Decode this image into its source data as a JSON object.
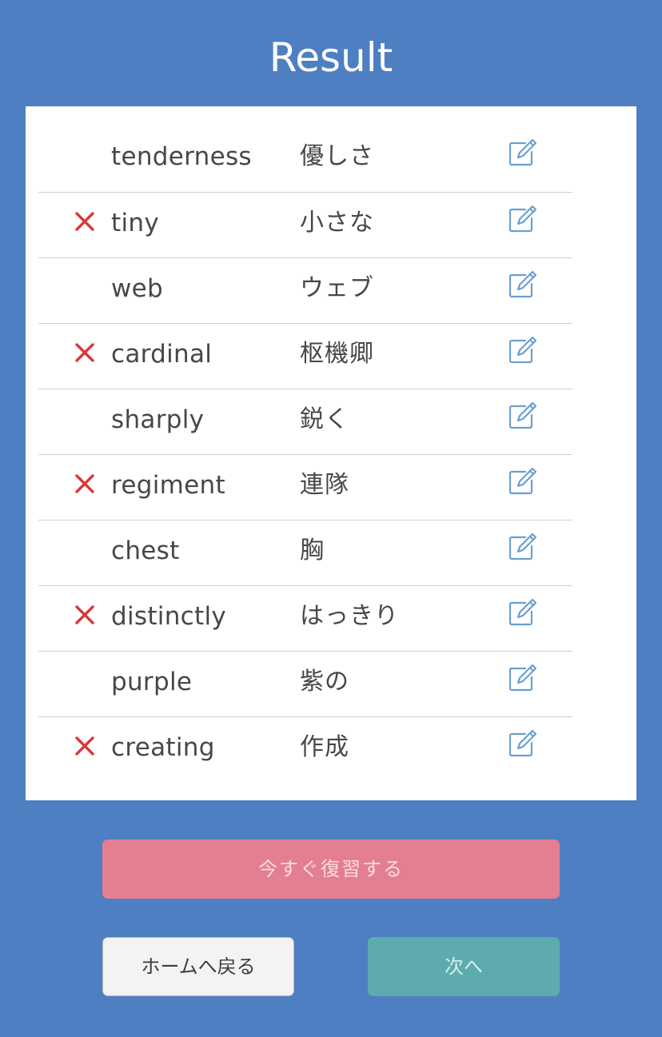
{
  "header": {
    "title": "Result"
  },
  "results": {
    "items": [
      {
        "word": "tenderness",
        "meaning": "優しさ",
        "incorrect": false
      },
      {
        "word": "tiny",
        "meaning": "小さな",
        "incorrect": true
      },
      {
        "word": "web",
        "meaning": "ウェブ",
        "incorrect": false
      },
      {
        "word": "cardinal",
        "meaning": "枢機卿",
        "incorrect": true
      },
      {
        "word": "sharply",
        "meaning": "鋭く",
        "incorrect": false
      },
      {
        "word": "regiment",
        "meaning": "連隊",
        "incorrect": true
      },
      {
        "word": "chest",
        "meaning": "胸",
        "incorrect": false
      },
      {
        "word": "distinctly",
        "meaning": "はっきり",
        "incorrect": true
      },
      {
        "word": "purple",
        "meaning": "紫の",
        "incorrect": false
      },
      {
        "word": "creating",
        "meaning": "作成",
        "incorrect": true
      }
    ],
    "incorrect_icon": "cross-icon",
    "edit_icon": "edit-icon"
  },
  "actions": {
    "review_now_label": "今すぐ復習する",
    "home_label": "ホームへ戻る",
    "next_label": "次へ"
  },
  "colors": {
    "background": "#4d7fc2",
    "card": "#ffffff",
    "incorrect_mark": "#d9373b",
    "edit_icon": "#6a9fd2",
    "review_button": "#e47f91",
    "home_button": "#f3f3f3",
    "next_button": "#5eabaf"
  }
}
